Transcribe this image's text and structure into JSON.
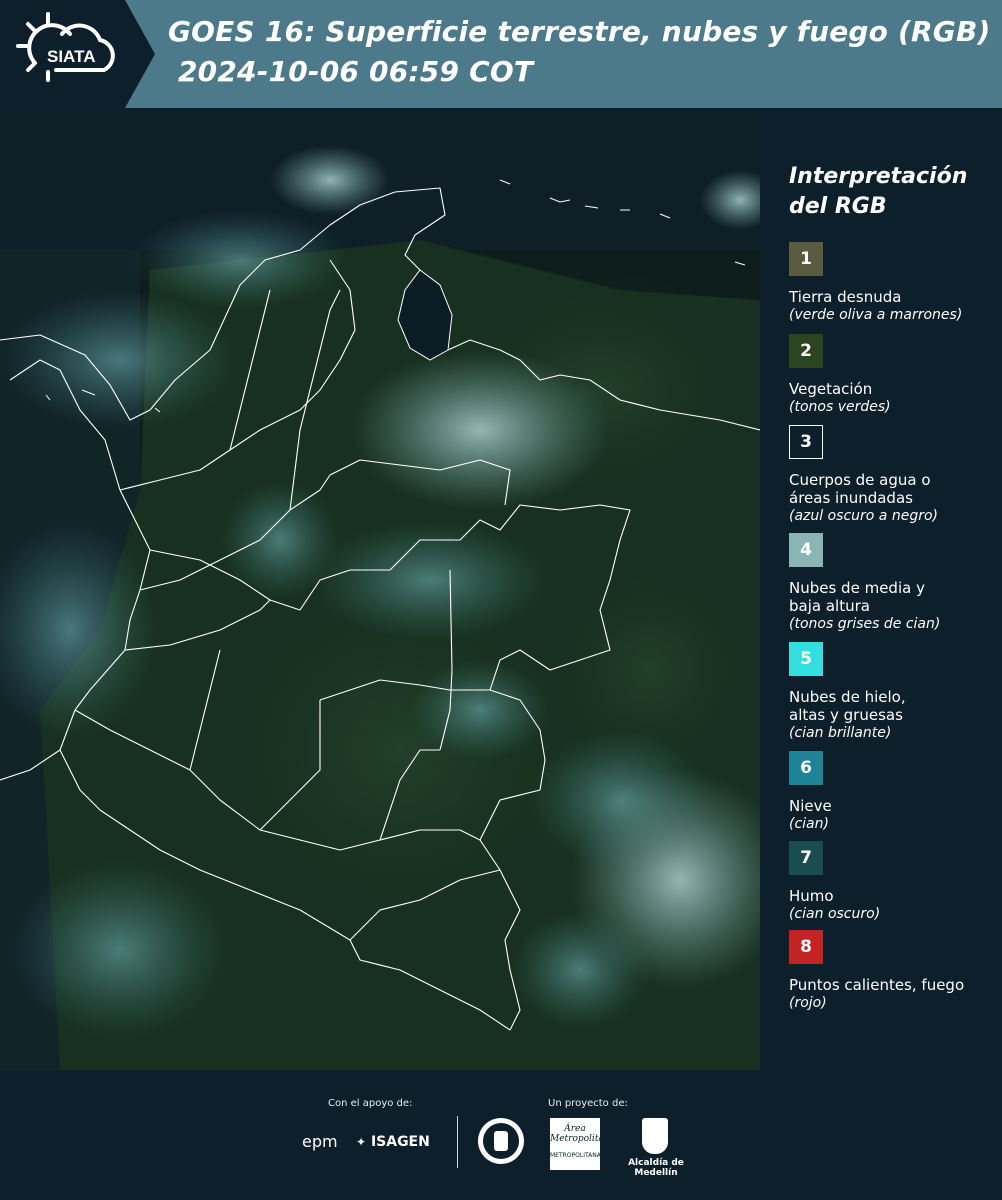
{
  "header": {
    "logo_text": "SIATA",
    "title_line1": "GOES 16: Superficie terrestre, nubes y fuego (RGB)",
    "title_line2": "2024-10-06 06:59 COT"
  },
  "legend": {
    "title_line1": "Interpretación",
    "title_line2": "del RGB",
    "items": [
      {
        "num": "1",
        "color": "#5b5b3f",
        "label": "Tierra desnuda",
        "sub": "(verde oliva a marrones)"
      },
      {
        "num": "2",
        "color": "#2d4421",
        "label": "Vegetación",
        "sub": "(tonos verdes)"
      },
      {
        "num": "3",
        "color": "#0c1f2b",
        "label_l1": "Cuerpos de agua o",
        "label_l2": "áreas inundadas",
        "sub": "(azul oscuro a negro)"
      },
      {
        "num": "4",
        "color": "#8bb5b5",
        "label_l1": "Nubes de media y",
        "label_l2": "baja altura",
        "sub": "(tonos grises de cian)"
      },
      {
        "num": "5",
        "color": "#33dede",
        "label_l1": "Nubes de hielo,",
        "label_l2": "altas y gruesas",
        "sub": "(cian brillante)"
      },
      {
        "num": "6",
        "color": "#1e8397",
        "label": "Nieve",
        "sub": "(cian)"
      },
      {
        "num": "7",
        "color": "#1a4d50",
        "label": "Humo",
        "sub": "(cian oscuro)"
      },
      {
        "num": "8",
        "color": "#c32323",
        "label": "Puntos calientes, fuego",
        "sub": "(rojo)"
      }
    ]
  },
  "footer": {
    "support_label": "Con el apoyo de:",
    "project_label": "Un proyecto de:",
    "partners": [
      "epm",
      "ISAGEN",
      "Área Metropolitana",
      "Alcaldía de Medellín"
    ],
    "area_sub": "METROPOLITANA"
  },
  "map": {
    "description_colors": {
      "vegetation": "#1d3320",
      "cloud": "#8fb8b8",
      "border": "#ffffff"
    }
  }
}
